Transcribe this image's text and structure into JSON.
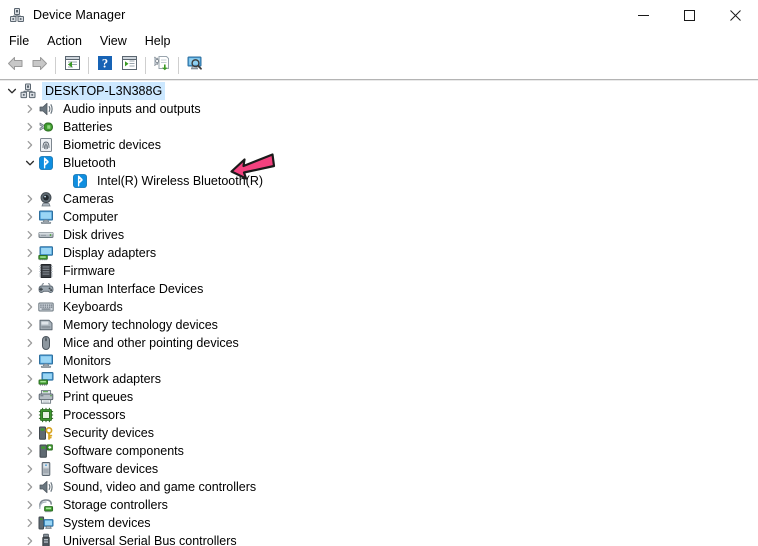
{
  "window": {
    "title": "Device Manager",
    "icon": "device-manager-icon",
    "controls": {
      "minimize": "minimize",
      "maximize": "maximize",
      "close": "close"
    }
  },
  "menubar": {
    "items": [
      {
        "label": "File"
      },
      {
        "label": "Action"
      },
      {
        "label": "View"
      },
      {
        "label": "Help"
      }
    ]
  },
  "toolbar": {
    "buttons": [
      {
        "name": "back-button",
        "icon": "back-arrow-icon",
        "tooltip": "Back"
      },
      {
        "name": "forward-button",
        "icon": "forward-arrow-icon",
        "tooltip": "Forward"
      },
      {
        "name": "properties-button",
        "icon": "properties-icon",
        "tooltip": "Properties"
      },
      {
        "name": "help-button",
        "icon": "help-question-icon",
        "tooltip": "Help"
      },
      {
        "name": "show-hide-console-tree-button",
        "icon": "console-tree-icon",
        "tooltip": "Show/Hide Console Tree"
      },
      {
        "name": "update-driver-button",
        "icon": "update-driver-icon",
        "tooltip": "Update driver"
      },
      {
        "name": "scan-hardware-changes-button",
        "icon": "scan-hardware-icon",
        "tooltip": "Scan for hardware changes"
      }
    ]
  },
  "tree": {
    "nodes": [
      {
        "label": "DESKTOP-L3N388G",
        "level": 0,
        "state": "expanded",
        "selected": true,
        "icon": "computer-device-icon"
      },
      {
        "label": "Audio inputs and outputs",
        "level": 1,
        "state": "collapsed",
        "selected": false,
        "icon": "speaker-icon"
      },
      {
        "label": "Batteries",
        "level": 1,
        "state": "collapsed",
        "selected": false,
        "icon": "battery-icon"
      },
      {
        "label": "Biometric devices",
        "level": 1,
        "state": "collapsed",
        "selected": false,
        "icon": "fingerprint-icon"
      },
      {
        "label": "Bluetooth",
        "level": 1,
        "state": "expanded",
        "selected": false,
        "icon": "bluetooth-icon"
      },
      {
        "label": "Intel(R) Wireless Bluetooth(R)",
        "level": 2,
        "state": "leaf",
        "selected": false,
        "icon": "bluetooth-icon"
      },
      {
        "label": "Cameras",
        "level": 1,
        "state": "collapsed",
        "selected": false,
        "icon": "camera-icon"
      },
      {
        "label": "Computer",
        "level": 1,
        "state": "collapsed",
        "selected": false,
        "icon": "monitor-icon"
      },
      {
        "label": "Disk drives",
        "level": 1,
        "state": "collapsed",
        "selected": false,
        "icon": "disk-drive-icon"
      },
      {
        "label": "Display adapters",
        "level": 1,
        "state": "collapsed",
        "selected": false,
        "icon": "display-adapter-icon"
      },
      {
        "label": "Firmware",
        "level": 1,
        "state": "collapsed",
        "selected": false,
        "icon": "firmware-chip-icon"
      },
      {
        "label": "Human Interface Devices",
        "level": 1,
        "state": "collapsed",
        "selected": false,
        "icon": "gamepad-icon"
      },
      {
        "label": "Keyboards",
        "level": 1,
        "state": "collapsed",
        "selected": false,
        "icon": "keyboard-icon"
      },
      {
        "label": "Memory technology devices",
        "level": 1,
        "state": "collapsed",
        "selected": false,
        "icon": "memory-card-icon"
      },
      {
        "label": "Mice and other pointing devices",
        "level": 1,
        "state": "collapsed",
        "selected": false,
        "icon": "mouse-icon"
      },
      {
        "label": "Monitors",
        "level": 1,
        "state": "collapsed",
        "selected": false,
        "icon": "monitor-icon"
      },
      {
        "label": "Network adapters",
        "level": 1,
        "state": "collapsed",
        "selected": false,
        "icon": "network-adapter-icon"
      },
      {
        "label": "Print queues",
        "level": 1,
        "state": "collapsed",
        "selected": false,
        "icon": "printer-icon"
      },
      {
        "label": "Processors",
        "level": 1,
        "state": "collapsed",
        "selected": false,
        "icon": "processor-chip-icon"
      },
      {
        "label": "Security devices",
        "level": 1,
        "state": "collapsed",
        "selected": false,
        "icon": "security-key-icon"
      },
      {
        "label": "Software components",
        "level": 1,
        "state": "collapsed",
        "selected": false,
        "icon": "software-component-icon"
      },
      {
        "label": "Software devices",
        "level": 1,
        "state": "collapsed",
        "selected": false,
        "icon": "software-device-icon"
      },
      {
        "label": "Sound, video and game controllers",
        "level": 1,
        "state": "collapsed",
        "selected": false,
        "icon": "speaker-icon"
      },
      {
        "label": "Storage controllers",
        "level": 1,
        "state": "collapsed",
        "selected": false,
        "icon": "storage-controller-icon"
      },
      {
        "label": "System devices",
        "level": 1,
        "state": "collapsed",
        "selected": false,
        "icon": "system-device-icon"
      },
      {
        "label": "Universal Serial Bus controllers",
        "level": 1,
        "state": "collapsed",
        "selected": false,
        "icon": "usb-icon"
      }
    ]
  },
  "annotation": {
    "name": "pink-arrow-annotation",
    "points_at": "Intel(R) Wireless Bluetooth(R)",
    "direction": "left",
    "fill_color": "#F2417E",
    "stroke_color": "#1A1A1A"
  },
  "colors": {
    "selection": "#cce8ff",
    "bluetooth_blue": "#1a8fe0",
    "accent_green": "#3a9a22",
    "text": "#000000",
    "window_bg": "#ffffff"
  }
}
